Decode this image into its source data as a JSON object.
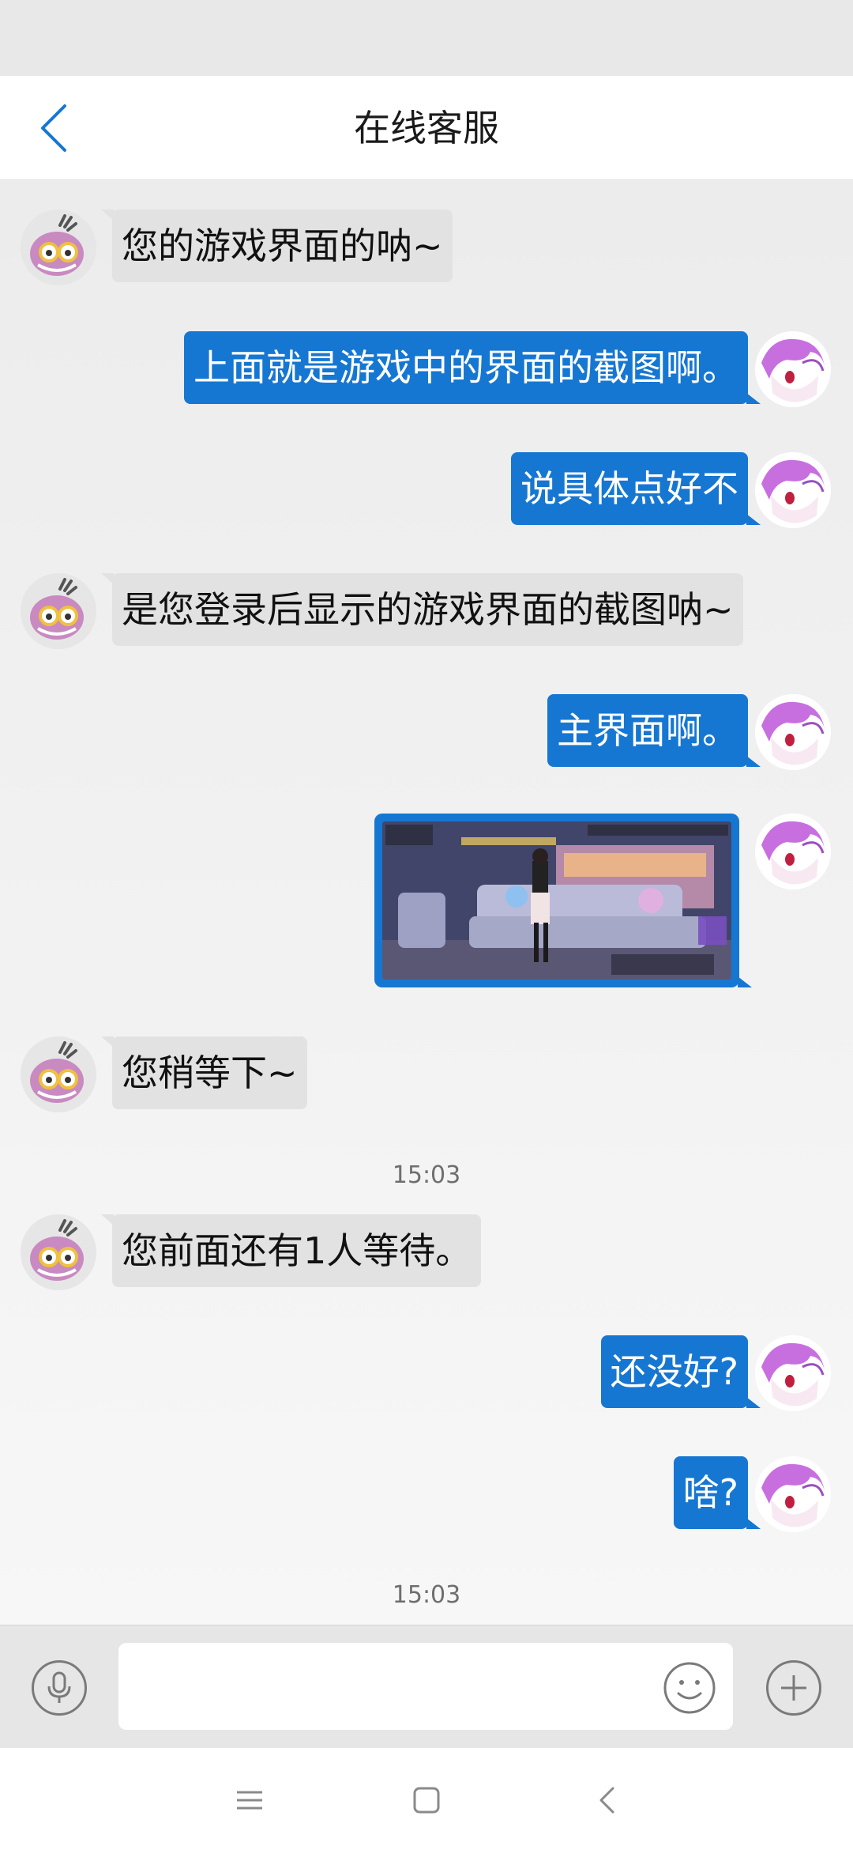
{
  "header": {
    "title": "在线客服",
    "back_icon": "chevron-left-icon"
  },
  "colors": {
    "accent": "#1677d2",
    "agent_bubble": "#e2e2e2",
    "header_bg": "#ffffff",
    "chat_bg": "#efefef"
  },
  "messages": [
    {
      "from": "agent",
      "text": "您的游戏界面的呐~"
    },
    {
      "from": "user",
      "text": "上面就是游戏中的界面的截图啊。"
    },
    {
      "from": "user",
      "text": "说具体点好不"
    },
    {
      "from": "agent",
      "text": "是您登录后显示的游戏界面的截图呐~"
    },
    {
      "from": "user",
      "text": "主界面啊。"
    },
    {
      "from": "user",
      "type": "image",
      "alt": "game-screenshot"
    },
    {
      "from": "agent",
      "text": "您稍等下~"
    },
    {
      "from": "system",
      "text": "15:03"
    },
    {
      "from": "agent",
      "text": "您前面还有1人等待。"
    },
    {
      "from": "user",
      "text": "还没好?"
    },
    {
      "from": "user",
      "text": "啥?"
    },
    {
      "from": "system",
      "text": "15:03"
    }
  ],
  "input_bar": {
    "voice_icon": "microphone-icon",
    "emoji_icon": "smiley-icon",
    "more_icon": "plus-icon",
    "text_value": "",
    "placeholder": ""
  },
  "system_nav": {
    "menu_icon": "menu-icon",
    "home_icon": "home-icon",
    "back_icon": "back-icon"
  }
}
